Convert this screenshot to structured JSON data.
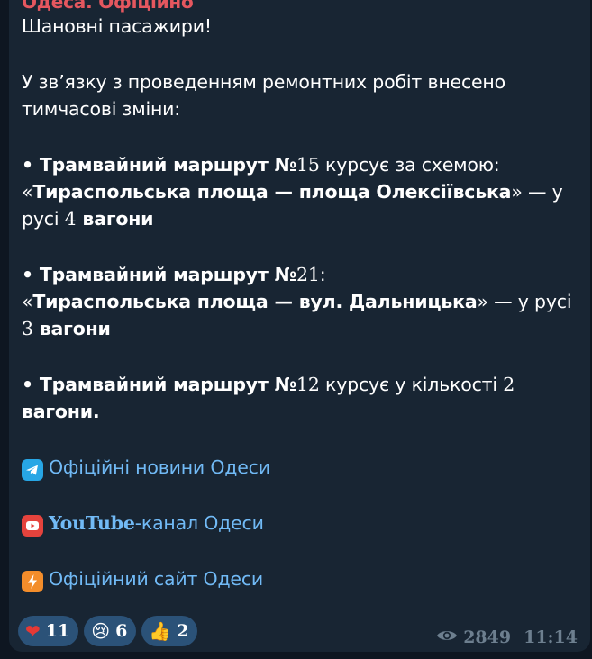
{
  "channel": {
    "name": "Одеса. Офіційно"
  },
  "message": {
    "greeting": "Шановні пасажири!",
    "intro_1": "У зв’язку з проведенням ремонтних робіт внесено",
    "intro_2": "тимчасові зміни:",
    "route15": {
      "bullet": "• ",
      "title": "Трамвайний маршрут №",
      "number": "15",
      "rest": " курсує за схемою:",
      "q_open": "«",
      "route": "Тираспольська площа — площа Олексіївська",
      "q_close": "»",
      "tail": " — у",
      "line3_pre": "русі ",
      "count": "4",
      "wagons": " вагони"
    },
    "route21": {
      "bullet": "• ",
      "title": "Трамвайний маршрут №",
      "number": "21",
      "colon": ":",
      "q_open": "«",
      "route": "Тираспольська площа — вул. Дальницька",
      "q_close": "»",
      "tail": " — у русі",
      "count": "3",
      "wagons": " вагони"
    },
    "route12": {
      "bullet": "• ",
      "title": "Трамвайний маршрут №",
      "number": "12",
      "rest": " курсує у кількості ",
      "count": "2",
      "wagons": "вагони."
    },
    "links": [
      {
        "icon": "telegram-icon",
        "text": "Офіційні новини Одеси"
      },
      {
        "icon": "youtube-icon",
        "text_serif": "YouTube",
        "text": "-канал Одеси"
      },
      {
        "icon": "lightning-icon",
        "text": "Офіційний сайт Одеси"
      }
    ]
  },
  "reactions": [
    {
      "emoji": "❤",
      "count": "11"
    },
    {
      "emoji": "😢",
      "count": "6"
    },
    {
      "emoji": "👍",
      "count": "2"
    }
  ],
  "meta": {
    "views": "2849",
    "time": "11:14"
  },
  "colors": {
    "background": "#0e1621",
    "bubble": "#182533",
    "sender": "#e5575f",
    "link": "#71baf6",
    "reaction_bg": "#2b5278",
    "meta": "#6d7f8f"
  }
}
